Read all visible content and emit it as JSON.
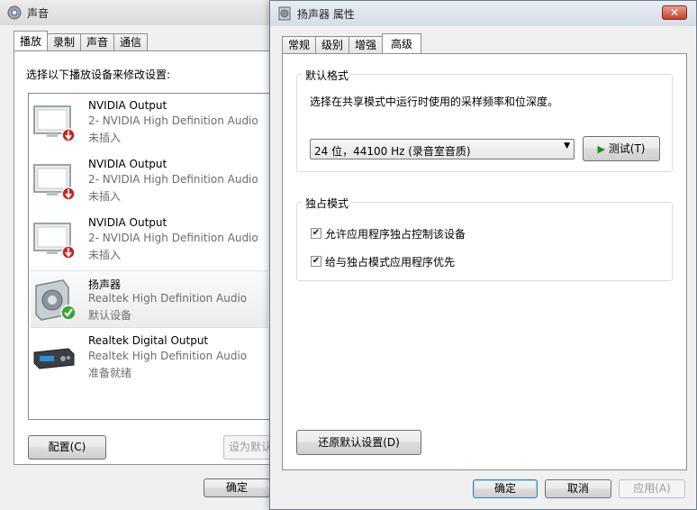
{
  "sound_window": {
    "title": "声音",
    "tabs": [
      "播放",
      "录制",
      "声音",
      "通信"
    ],
    "instruction": "选择以下播放设备来修改设置:",
    "devices": [
      {
        "name": "NVIDIA Output",
        "desc": "2- NVIDIA High Definition Audio",
        "status": "未插入"
      },
      {
        "name": "NVIDIA Output",
        "desc": "2- NVIDIA High Definition Audio",
        "status": "未插入"
      },
      {
        "name": "NVIDIA Output",
        "desc": "2- NVIDIA High Definition Audio",
        "status": "未插入"
      },
      {
        "name": "扬声器",
        "desc": "Realtek High Definition Audio",
        "status": "默认设备"
      },
      {
        "name": "Realtek Digital Output",
        "desc": "Realtek High Definition Audio",
        "status": "准备就绪"
      }
    ],
    "configure_label": "配置(C)",
    "set_default_label": "设为默认",
    "ok_label": "确定"
  },
  "props_window": {
    "title": "扬声器 属性",
    "close_glyph": "✕",
    "tabs": [
      "常规",
      "级别",
      "增强",
      "高级"
    ],
    "default_format": {
      "group_label": "默认格式",
      "description": "选择在共享模式中运行时使用的采样频率和位深度。",
      "selected": "24 位，44100 Hz (录音室音质)",
      "test_label": "测试(T)"
    },
    "exclusive": {
      "group_label": "独占模式",
      "options": [
        {
          "label": "允许应用程序独占控制该设备",
          "checked": true
        },
        {
          "label": "给与独占模式应用程序优先",
          "checked": true
        }
      ]
    },
    "restore_label": "还原默认设置(D)",
    "ok_label": "确定",
    "cancel_label": "取消",
    "apply_label": "应用(A)"
  }
}
